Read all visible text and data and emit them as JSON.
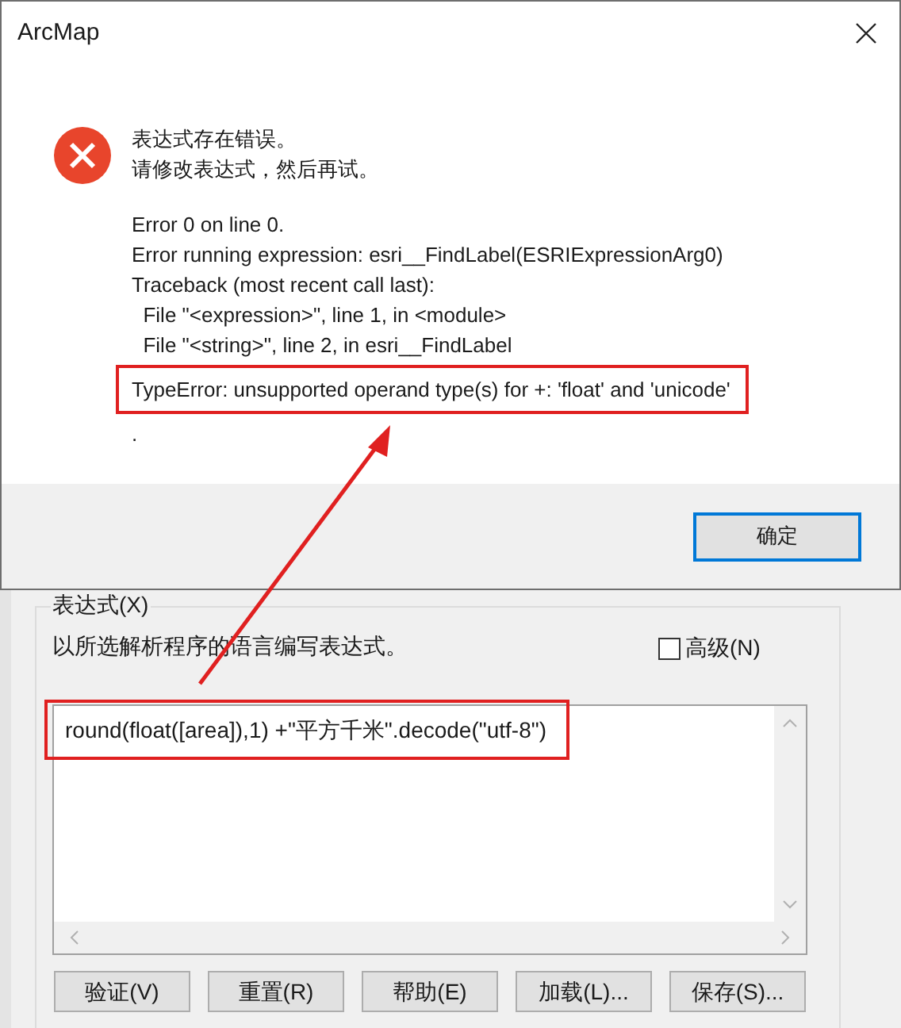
{
  "dialog": {
    "title": "ArcMap",
    "message": [
      "表达式存在错误。",
      "请修改表达式，然后再试。"
    ],
    "details": [
      {
        "text": "Error 0 on line 0.",
        "highlighted": false
      },
      {
        "text": "Error running expression: esri__FindLabel(ESRIExpressionArg0)",
        "highlighted": false
      },
      {
        "text": "Traceback (most recent call last):",
        "highlighted": false
      },
      {
        "text": "  File \"<expression>\", line 1, in <module>",
        "highlighted": false
      },
      {
        "text": "  File \"<string>\", line 2, in esri__FindLabel",
        "highlighted": false
      },
      {
        "text": "TypeError: unsupported operand type(s) for +: 'float' and 'unicode'",
        "highlighted": true
      },
      {
        "text": ".",
        "highlighted": false
      }
    ],
    "buttons": [
      {
        "label": "确定",
        "default": true
      }
    ]
  },
  "expression_panel": {
    "group_label": "表达式(X)",
    "hint": "以所选解析程序的语言编写表达式。",
    "advanced": {
      "label": "高级(N)",
      "checked": false
    },
    "expression": {
      "text": "round(float([area]),1) +\"平方千米\".decode(\"utf-8\")",
      "highlighted": true
    },
    "buttons": [
      "验证(V)",
      "重置(R)",
      "帮助(E)",
      "加载(L)...",
      "保存(S)..."
    ]
  }
}
